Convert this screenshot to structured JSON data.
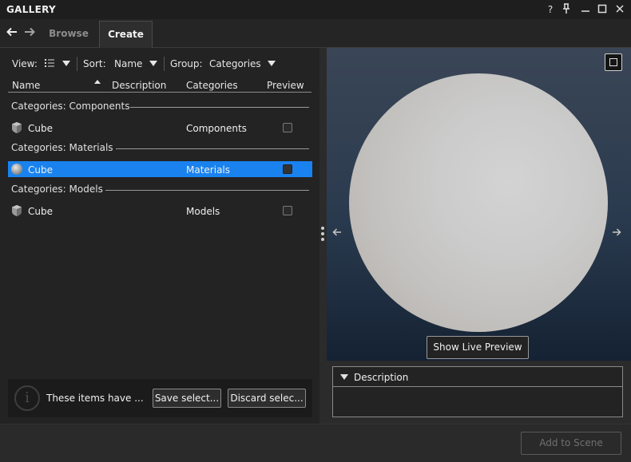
{
  "window": {
    "title": "GALLERY",
    "controls": {
      "help": "?",
      "pin": "⊥",
      "minimize": "—",
      "maximize": "☐",
      "close": "✕"
    }
  },
  "nav": {
    "back": "🡐",
    "forward": "🡒"
  },
  "tabs": [
    {
      "label": "Browse",
      "active": false
    },
    {
      "label": "Create",
      "active": true
    }
  ],
  "toolbar": {
    "view_label": "View:",
    "sort_label": "Sort:",
    "sort_value": "Name",
    "group_label": "Group:",
    "group_value": "Categories"
  },
  "columns": {
    "name": "Name",
    "description": "Description",
    "categories": "Categories",
    "preview": "Preview"
  },
  "groups": [
    {
      "header": "Categories: Components",
      "items": [
        {
          "name": "Cube",
          "category": "Components",
          "icon": "cube-icon",
          "selected": false
        }
      ]
    },
    {
      "header": "Categories: Materials",
      "items": [
        {
          "name": "Cube",
          "category": "Materials",
          "icon": "sphere-icon",
          "selected": true
        }
      ]
    },
    {
      "header": "Categories: Models",
      "items": [
        {
          "name": "Cube",
          "category": "Models",
          "icon": "cube-icon",
          "selected": false
        }
      ]
    }
  ],
  "infobar": {
    "icon": "i",
    "message": "These items have ...",
    "save_label": "Save select...",
    "discard_label": "Discard selec..."
  },
  "preview": {
    "prev": "🡐",
    "next": "🡒",
    "live_preview_label": "Show Live Preview"
  },
  "description": {
    "title": "Description"
  },
  "footer": {
    "add_label": "Add to Scene"
  },
  "colors": {
    "selection": "#1a82ef",
    "background": "#2b2b2b",
    "panel": "#232323"
  }
}
